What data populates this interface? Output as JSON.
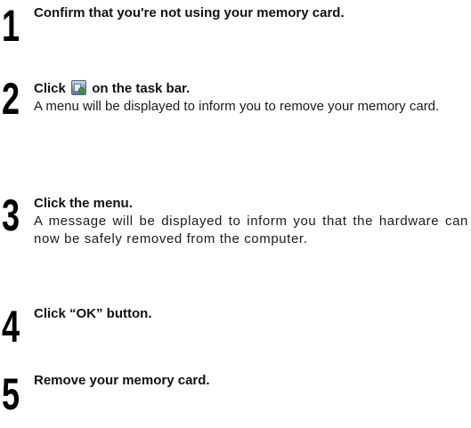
{
  "steps": [
    {
      "number": "1",
      "title": "Confirm that you're not using your memory card.",
      "description": ""
    },
    {
      "number": "2",
      "title_before_icon": "Click",
      "title_icon": "taskbar-safely-remove-hardware-icon",
      "title_after_icon": "on the task bar.",
      "description": "A menu will be displayed to inform you to remove your memory card."
    },
    {
      "number": "3",
      "title": "Click the menu.",
      "description": "A message will be displayed to inform you that the hardware can now be safely removed from the computer."
    },
    {
      "number": "4",
      "title": "Click “OK” button.",
      "description": ""
    },
    {
      "number": "5",
      "title": "Remove your memory card.",
      "description": ""
    }
  ]
}
